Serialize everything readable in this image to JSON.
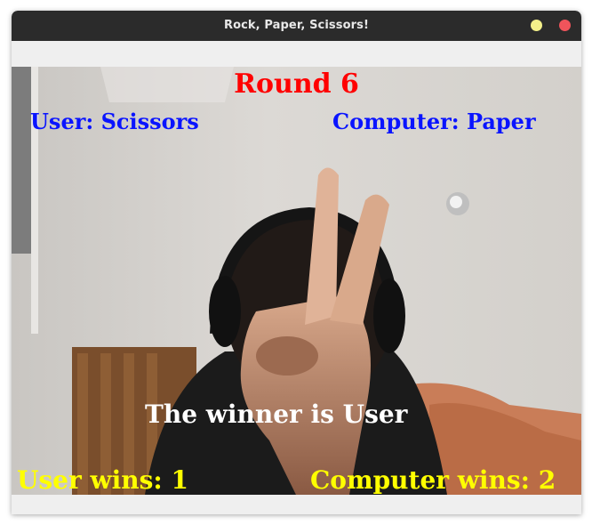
{
  "window": {
    "title": "Rock, Paper, Scissors!"
  },
  "overlay": {
    "round": "Round 6",
    "user_choice": "User: Scissors",
    "computer_choice": "Computer: Paper",
    "winner": "The winner is User",
    "user_wins": "User wins: 1",
    "computer_wins": "Computer wins: 2"
  },
  "colors": {
    "round": "#ff0000",
    "choices": "#0a14ff",
    "winner": "#ffffff",
    "scores": "#ffff00",
    "titlebar": "#2b2b2b",
    "minimize_button": "#f3f08a",
    "close_button": "#f0545b"
  },
  "icons": {
    "minimize": "minimize-icon",
    "close": "close-icon"
  }
}
